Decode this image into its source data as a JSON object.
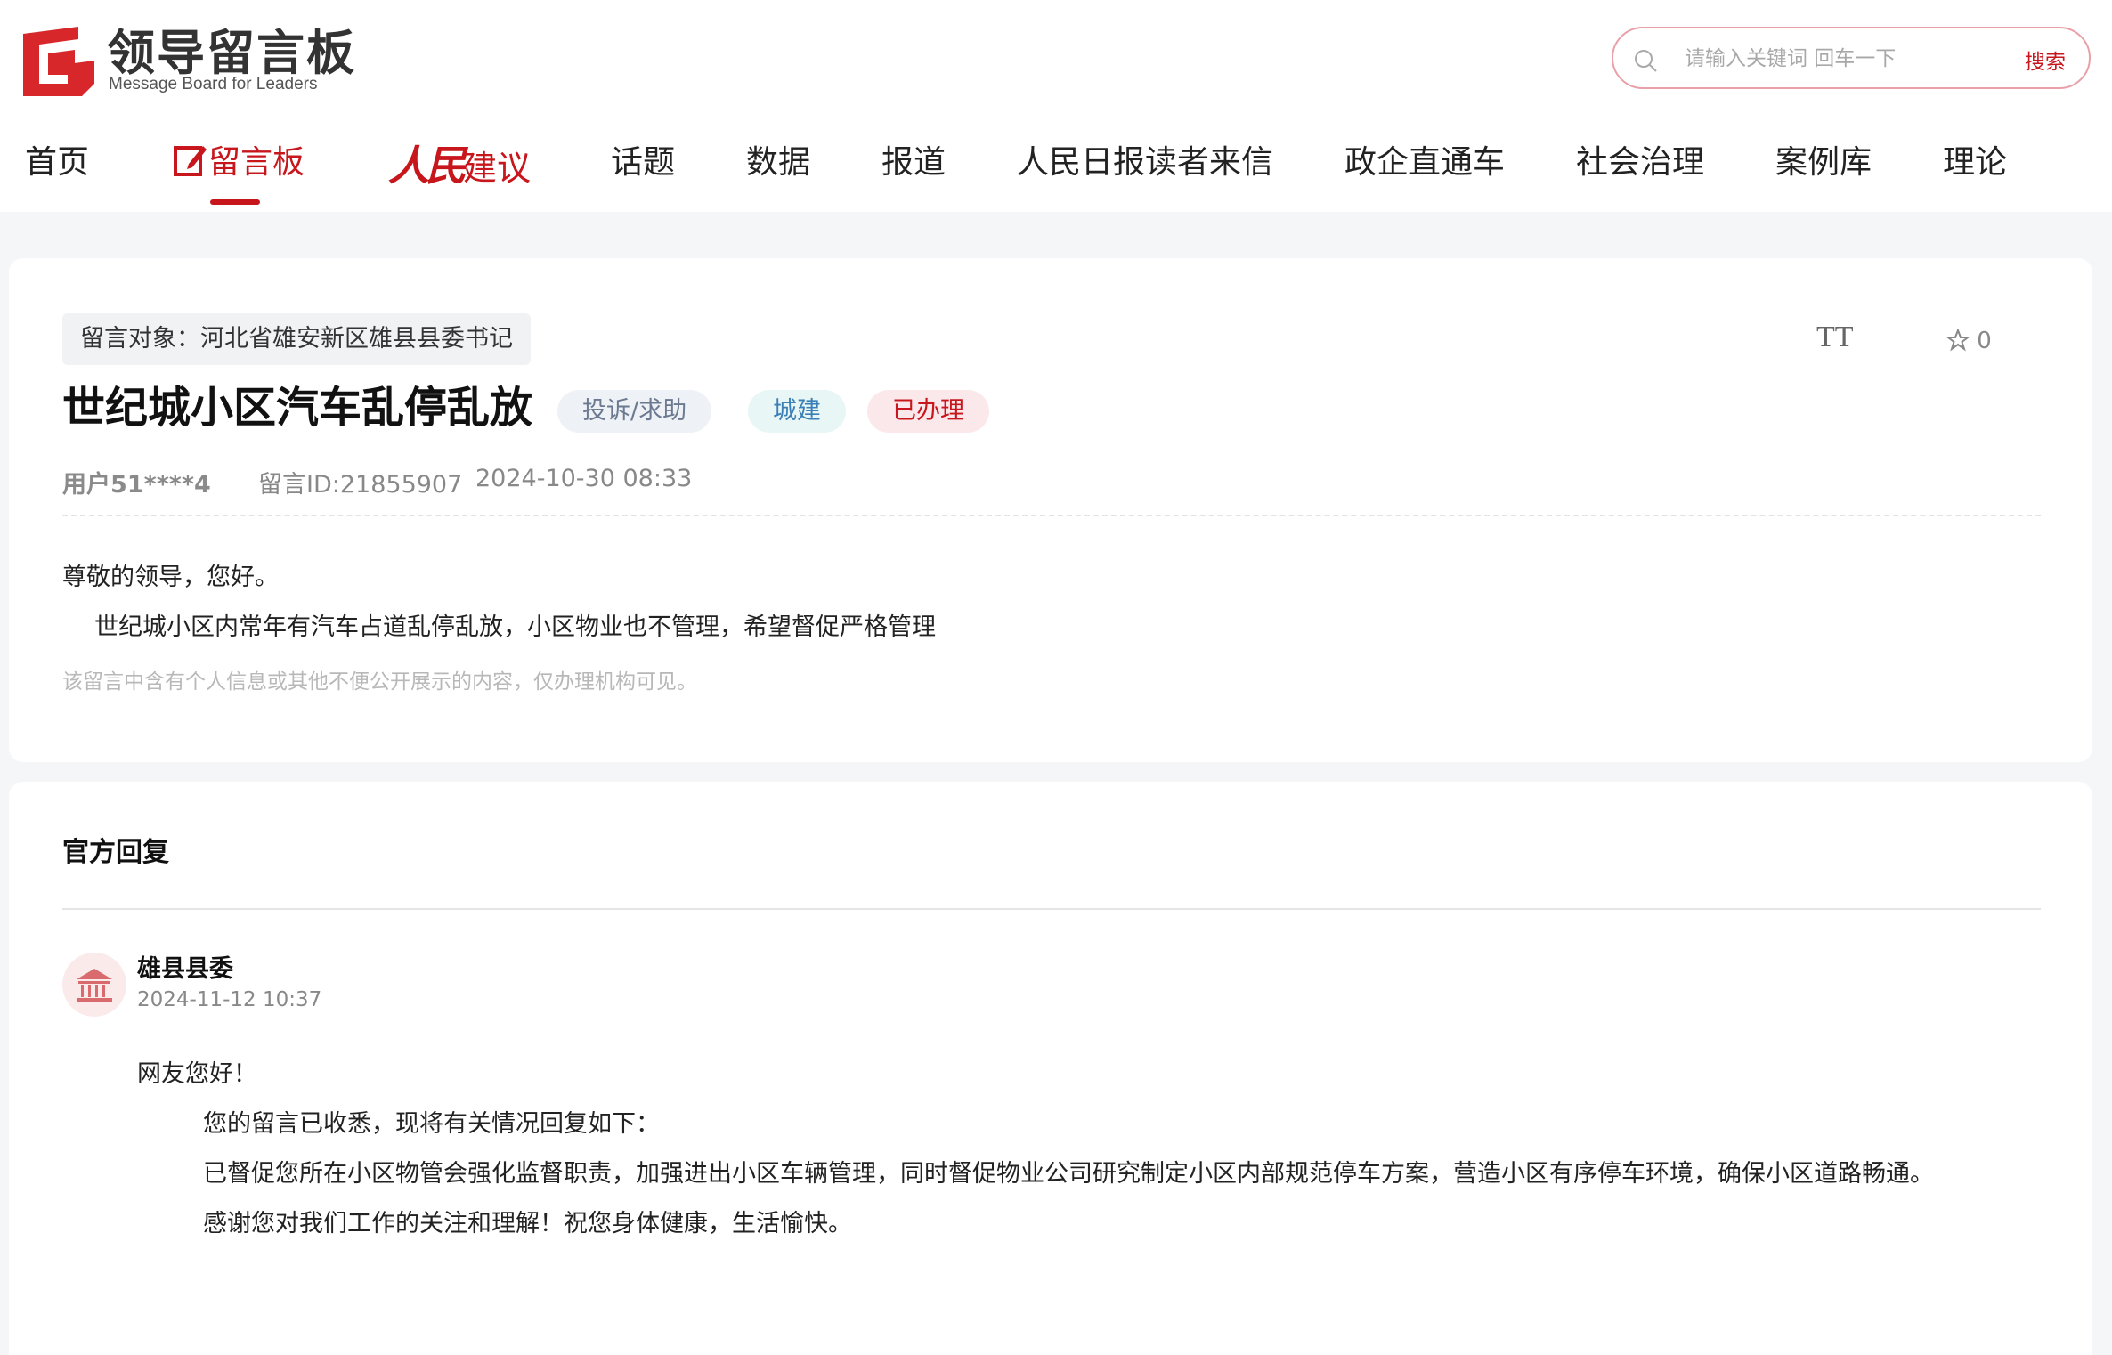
{
  "header": {
    "logo_cn": "领导留言板",
    "logo_en": "Message Board for Leaders",
    "search_placeholder": "请输入关键词 回车一下",
    "search_button": "搜索"
  },
  "nav": {
    "items": [
      "首页",
      "留言板",
      "人民建议",
      "话题",
      "数据",
      "报道",
      "人民日报读者来信",
      "政企直通车",
      "社会治理",
      "案例库",
      "理论"
    ],
    "active_index": 1,
    "brand_part1": "人民",
    "brand_part2": "建议"
  },
  "message": {
    "target": "留言对象：河北省雄安新区雄县县委书记",
    "font_tool_label": "TT",
    "favorite_count": "0",
    "title": "世纪城小区汽车乱停乱放",
    "badges": {
      "type": "投诉/求助",
      "category": "城建",
      "status": "已办理"
    },
    "user": "用户51****4",
    "message_id": "留言ID:21855907",
    "time": "2024-10-30 08:33",
    "greeting": "尊敬的领导，您好。",
    "content": "世纪城小区内常年有汽车占道乱停乱放，小区物业也不管理，希望督促严格管理",
    "notice": "该留言中含有个人信息或其他不便公开展示的内容，仅办理机构可见。"
  },
  "reply": {
    "section_title": "官方回复",
    "org_name": "雄县县委",
    "time": "2024-11-12 10:37",
    "lines": [
      "网友您好！",
      "您的留言已收悉，现将有关情况回复如下：",
      "已督促您所在小区物管会强化监督职责，加强进出小区车辆管理，同时督促物业公司研究制定小区内部规范停车方案，营造小区有序停车环境，确保小区道路畅通。",
      "感谢您对我们工作的关注和理解！祝您身体健康，生活愉快。"
    ]
  },
  "colors": {
    "brand_red": "#c8161d",
    "page_bg": "#f5f6f8"
  }
}
